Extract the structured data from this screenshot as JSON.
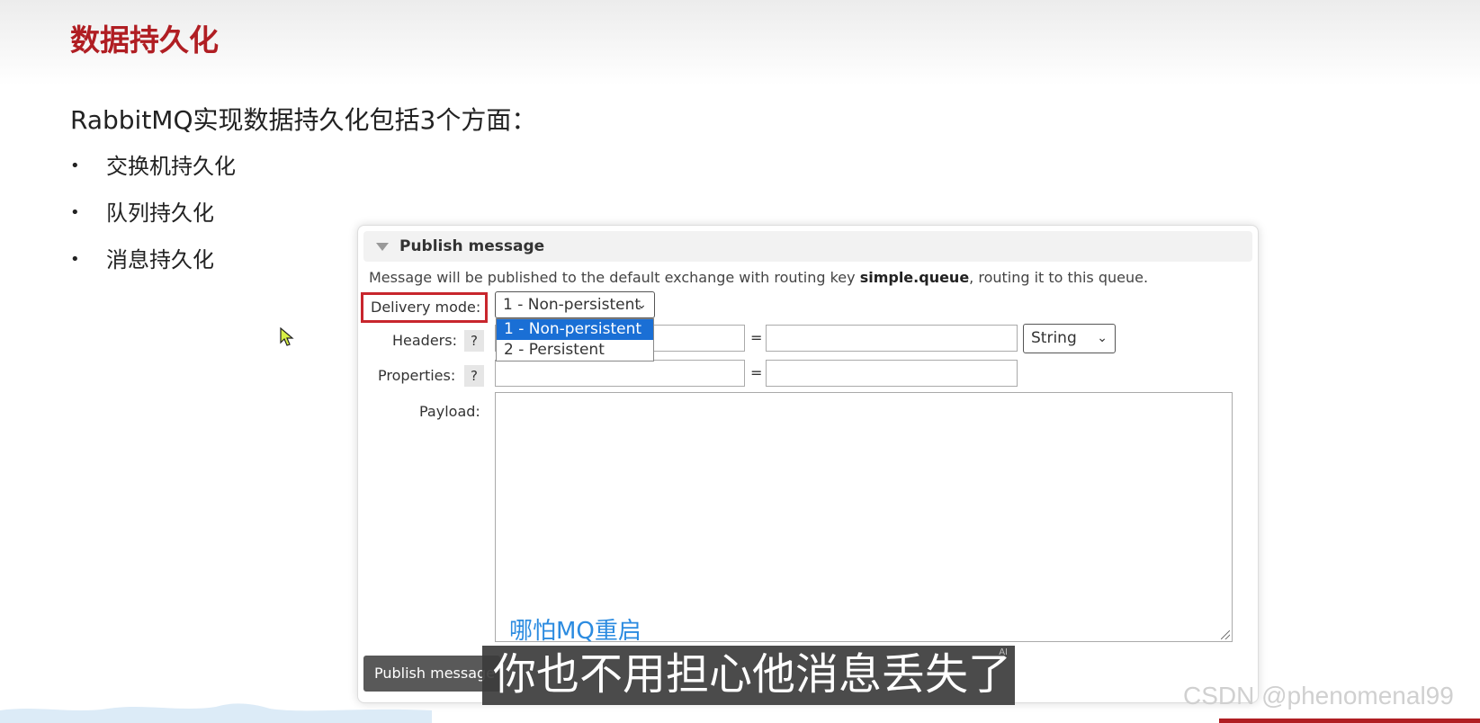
{
  "slide": {
    "title": "数据持久化",
    "intro": "RabbitMQ实现数据持久化包括3个方面：",
    "bullets": [
      "交换机持久化",
      "队列持久化",
      "消息持久化"
    ]
  },
  "publish_panel": {
    "title": "Publish message",
    "info_prefix": "Message will be published to the default exchange with routing key ",
    "routing_key": "simple.queue",
    "info_suffix": ", routing it to this queue.",
    "delivery_mode_label": "Delivery mode:",
    "delivery_mode_value": "1 - Non-persistent",
    "delivery_mode_options": [
      "1 - Non-persistent",
      "2 - Persistent"
    ],
    "headers_label": "Headers:",
    "properties_label": "Properties:",
    "help_label": "?",
    "equals": "=",
    "header_type": "String",
    "payload_label": "Payload:",
    "publish_button": "Publish message"
  },
  "subtitles": {
    "overlay_text": "哪怕MQ重启",
    "caption": "你也不用担心他消息丢失了",
    "ai_mark": "AI"
  },
  "watermark": "CSDN @phenomenal99",
  "colors": {
    "title_red": "#b01e23",
    "highlight_box": "#c8262d",
    "selected_option": "#1a6fd5",
    "subtitle_blue": "#2b8be0"
  }
}
